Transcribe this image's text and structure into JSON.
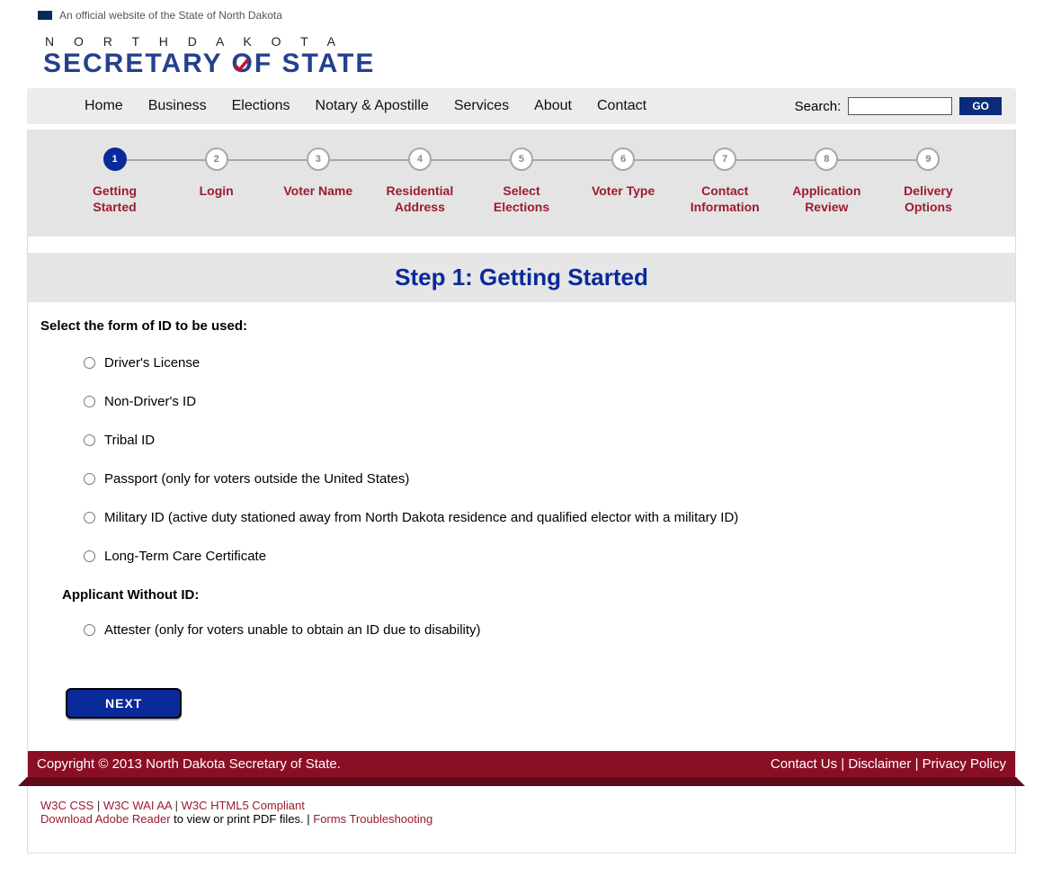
{
  "official_text": "An official website of the State of North Dakota",
  "logo": {
    "top": "N O R T H   D A K O T A",
    "main_pre": "SECRETARY ",
    "main_mid_o": "O",
    "main_post": "F STATE"
  },
  "nav": {
    "items": [
      "Home",
      "Business",
      "Elections",
      "Notary & Apostille",
      "Services",
      "About",
      "Contact"
    ],
    "search_label": "Search:",
    "go": "GO"
  },
  "progress": {
    "steps": [
      {
        "num": "1",
        "label": "Getting Started"
      },
      {
        "num": "2",
        "label": "Login"
      },
      {
        "num": "3",
        "label": "Voter Name"
      },
      {
        "num": "4",
        "label": "Residential Address"
      },
      {
        "num": "5",
        "label": "Select Elections"
      },
      {
        "num": "6",
        "label": "Voter Type"
      },
      {
        "num": "7",
        "label": "Contact Information"
      },
      {
        "num": "8",
        "label": "Application Review"
      },
      {
        "num": "9",
        "label": "Delivery Options"
      }
    ]
  },
  "step_title": "Step 1: Getting Started",
  "form": {
    "prompt": "Select the form of ID to be used:",
    "options": [
      "Driver's License",
      "Non-Driver's ID",
      "Tribal ID",
      "Passport (only for voters outside the United States)",
      "Military ID (active duty stationed away from North Dakota residence and qualified elector with a military ID)",
      "Long-Term Care Certificate"
    ],
    "sub_prompt": "Applicant Without ID:",
    "sub_options": [
      "Attester (only for voters unable to obtain an ID due to disability)"
    ],
    "next": "NEXT"
  },
  "footer": {
    "copyright": "Copyright © 2013 North Dakota Secretary of State.",
    "links": {
      "contact": "Contact Us",
      "disclaimer": "Disclaimer",
      "privacy": "Privacy Policy"
    }
  },
  "subfooter": {
    "w3c_css": "W3C CSS",
    "w3c_wai": "W3C WAI AA",
    "w3c_html5": "W3C HTML5 Compliant",
    "adobe": "Download Adobe Reader",
    "adobe_suffix": " to view or print PDF files.  |  ",
    "forms": "Forms Troubleshooting"
  }
}
